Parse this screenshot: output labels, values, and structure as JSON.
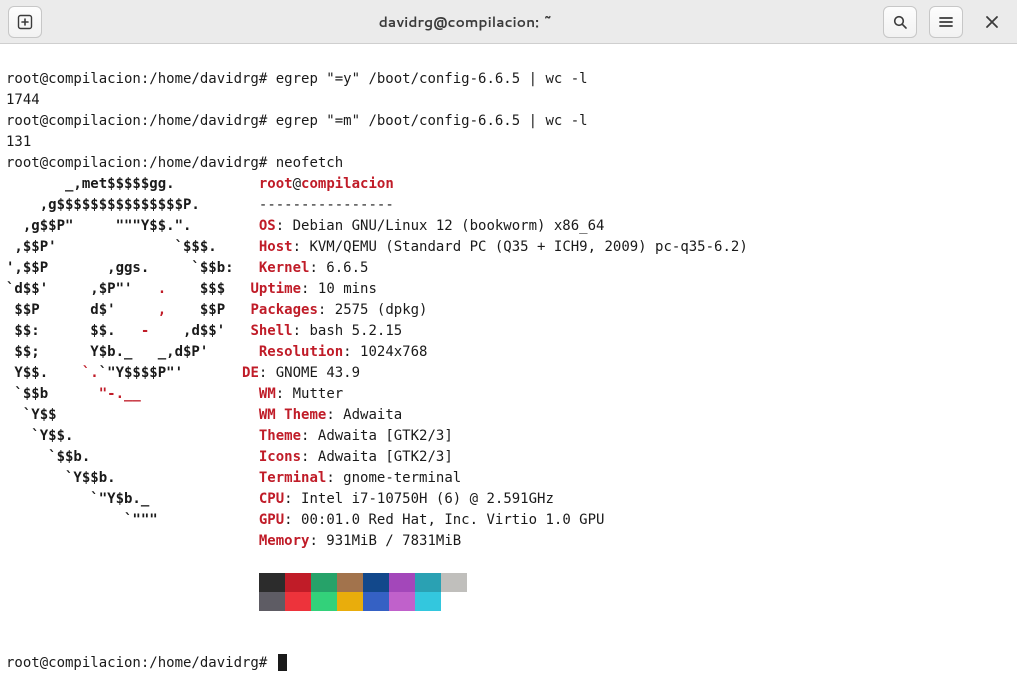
{
  "window": {
    "title": "davidrg@compilacion: ~"
  },
  "prompt": "root@compilacion:/home/davidrg#",
  "commands": {
    "cmd1": " egrep \"=y\" /boot/config-6.6.5 | wc -l",
    "out1": "1744",
    "cmd2": " egrep \"=m\" /boot/config-6.6.5 | wc -l",
    "out2": "131",
    "cmd3": " neofetch"
  },
  "neofetch": {
    "user": "root",
    "at": "@",
    "host": "compilacion",
    "sep": "----------------",
    "labels": {
      "os": "OS",
      "host": "Host",
      "kernel": "Kernel",
      "uptime": "Uptime",
      "packages": "Packages",
      "shell": "Shell",
      "resolution": "Resolution",
      "de": "DE",
      "wm": "WM",
      "wm_theme": "WM Theme",
      "theme": "Theme",
      "icons": "Icons",
      "terminal": "Terminal",
      "cpu": "CPU",
      "gpu": "GPU",
      "memory": "Memory"
    },
    "values": {
      "os": ": Debian GNU/Linux 12 (bookworm) x86_64",
      "host": ": KVM/QEMU (Standard PC (Q35 + ICH9, 2009) pc-q35-6.2)",
      "kernel": ": 6.6.5",
      "uptime": ": 10 mins",
      "packages": ": 2575 (dpkg)",
      "shell": ": bash 5.2.15",
      "resolution": ": 1024x768",
      "de": ": GNOME 43.9",
      "wm": ": Mutter",
      "wm_theme": ": Adwaita",
      "theme": ": Adwaita [GTK2/3]",
      "icons": ": Adwaita [GTK2/3]",
      "terminal": ": gnome-terminal",
      "cpu": ": Intel i7-10750H (6) @ 2.591GHz",
      "gpu": ": 00:01.0 Red Hat, Inc. Virtio 1.0 GPU",
      "memory": ": 931MiB / 7831MiB"
    },
    "colors_dark": [
      "#2c2c2c",
      "#c01c28",
      "#26a269",
      "#a2734c",
      "#12488b",
      "#a347ba",
      "#2aa1b3",
      "#c0bfbc"
    ],
    "colors_light": [
      "#5e5c64",
      "#ed333b",
      "#33d17a",
      "#e9ad0c",
      "#3561c4",
      "#c061cb",
      "#33c7de",
      "#ffffff"
    ]
  },
  "logo": {
    "l01a": "       _,met$$$$$gg.",
    "l02a": "    ,g$$$$$$$$$$$$$$$P.",
    "l03a": "  ,g$$P\"     \"\"\"Y$$.\".",
    "l04a": " ,$$P'              `$$$.",
    "l05a": "',$$P       ,ggs.     `$$b:",
    "l06a": "`d$$'     ,$P\"'   ",
    "l06r": ".",
    "l06b": "    $$$",
    "l07a": " $$P      d$'     ",
    "l07r": ",",
    "l07b": "    $$P",
    "l08a": " $$:      $$.   ",
    "l08r": "-",
    "l08b": "    ,d$$'",
    "l09a": " $$;      Y$b._   _,d$P'",
    "l10a": " Y$$.    ",
    "l10r": "`.",
    "l10b": "`\"Y$$$$P\"'",
    "l11a": " `$$b      ",
    "l11r": "\"-.__",
    "l12a": "  `Y$$",
    "l13a": "   `Y$$.",
    "l14a": "     `$$b.",
    "l15a": "       `Y$$b.",
    "l16a": "          `\"Y$b._",
    "l17a": "              `\"\"\""
  },
  "pad": {
    "p01": "          ",
    "p02": "       ",
    "p03": "        ",
    "p04": "     ",
    "p05": "   ",
    "p06": "   ",
    "p07": "   ",
    "p08": "   ",
    "p09": "      ",
    "p10": "       ",
    "p11": "              ",
    "p12": "                        ",
    "p13": "                      ",
    "p14": "                    ",
    "p15": "                 ",
    "p16": "             ",
    "p17": "            ",
    "swpad": "                              "
  }
}
